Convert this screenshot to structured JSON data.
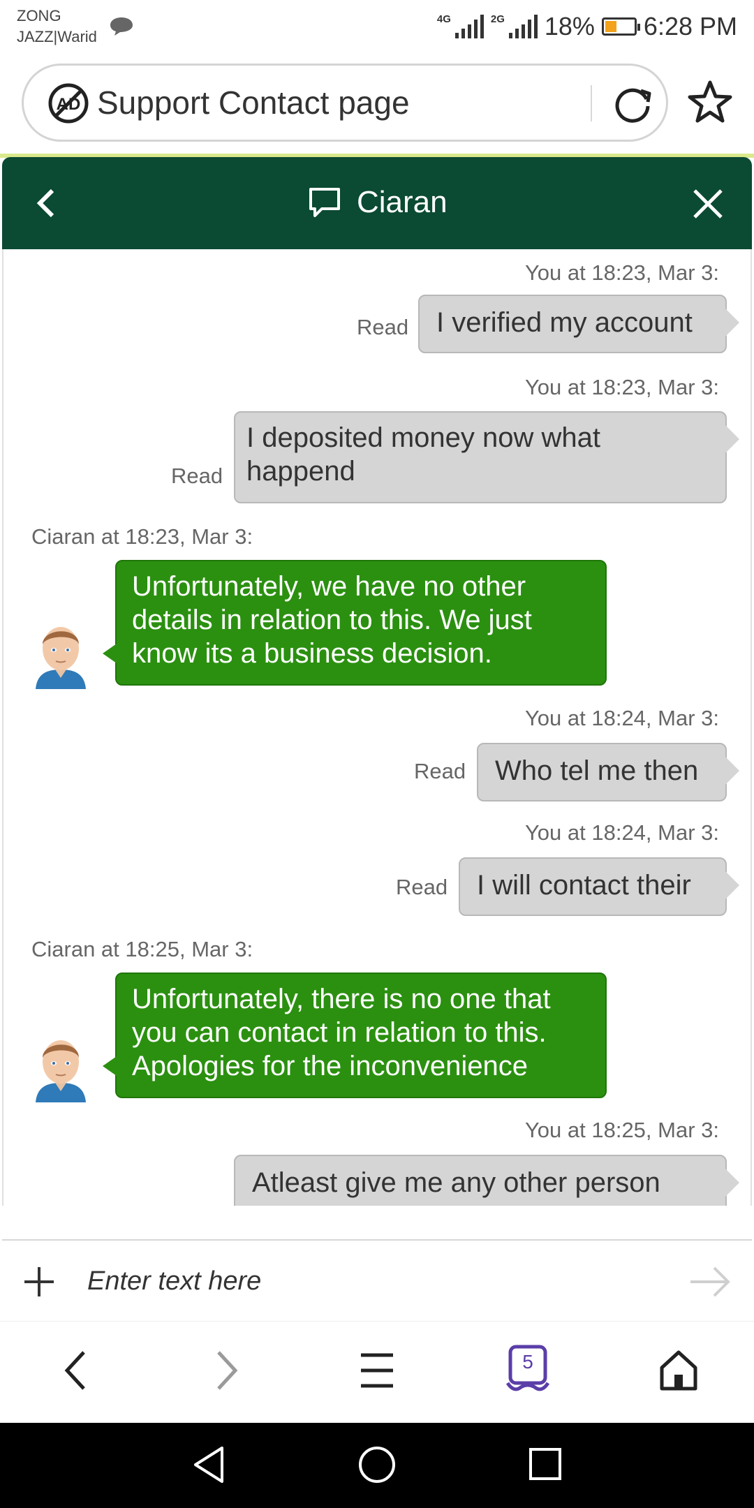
{
  "status_bar": {
    "carrier_line1": "ZONG",
    "carrier_line2": "JAZZ|Warid",
    "net1": "4G",
    "net2": "2G",
    "battery_percent": "18%",
    "battery_level": 0.18,
    "time": "6:28 PM"
  },
  "browser": {
    "page_title": "Support Contact page",
    "tab_count": "5"
  },
  "chat": {
    "agent_name": "Ciaran",
    "messages": [
      {
        "sender": "you",
        "timestamp": "You at 18:23, Mar 3:",
        "text": "I verified my account",
        "status": "Read"
      },
      {
        "sender": "you",
        "timestamp": "You at 18:23, Mar 3:",
        "text": " I deposited money now what happend",
        "status": "Read"
      },
      {
        "sender": "agent",
        "timestamp": "Ciaran at 18:23, Mar 3:",
        "text": "Unfortunately, we have no other details in relation to this. We just know its a business decision."
      },
      {
        "sender": "you",
        "timestamp": "You at 18:24, Mar 3:",
        "text": "Who tel me then",
        "status": "Read"
      },
      {
        "sender": "you",
        "timestamp": "You at 18:24, Mar 3:",
        "text": "I will contact their",
        "status": "Read"
      },
      {
        "sender": "agent",
        "timestamp": "Ciaran at 18:25, Mar 3:",
        "text": "Unfortunately, there is no one that you can contact in relation to this. Apologies for the inconvenience"
      },
      {
        "sender": "you",
        "timestamp": "You at 18:25, Mar 3:",
        "text": "Atleast give me any other person"
      }
    ],
    "input_placeholder": "Enter text here"
  },
  "colors": {
    "header_bg": "#0b4a33",
    "agent_bubble": "#2b9010",
    "user_bubble": "#d5d5d5",
    "tab_icon": "#5b3ea8"
  },
  "icons": {
    "adblock": "ad-block-icon",
    "reload": "reload-icon",
    "bookmark": "star-icon",
    "back": "chevron-left-icon",
    "chat": "chat-bubble-icon",
    "close": "close-icon",
    "attach": "plus-icon",
    "send": "send-arrow-icon"
  }
}
